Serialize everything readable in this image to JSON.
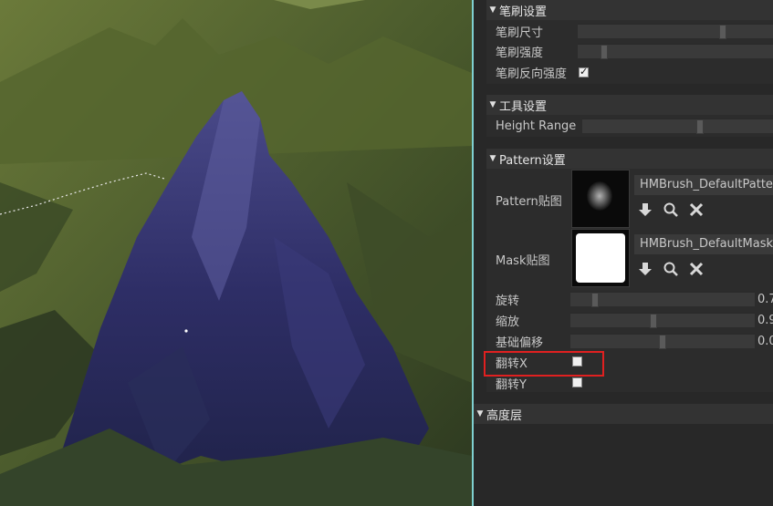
{
  "brush_settings": {
    "title": "笔刷设置",
    "brush_size_label": "笔刷尺寸",
    "brush_size_level": 0.75,
    "brush_strength_label": "笔刷强度",
    "brush_strength_level": 0.12,
    "invert_strength_label": "笔刷反向强度",
    "invert_strength_checked": true
  },
  "tool_settings": {
    "title": "工具设置",
    "height_range_label": "Height Range",
    "height_range_level": 0.62
  },
  "pattern_settings": {
    "title": "Pattern设置",
    "pattern_texture_label": "Pattern贴图",
    "pattern_texture_value": "HMBrush_DefaultPattern",
    "mask_texture_label": "Mask贴图",
    "mask_texture_value": "HMBrush_DefaultMask.",
    "rotation_label": "旋转",
    "rotation_value": "0.7",
    "rotation_level": 0.12,
    "scale_label": "缩放",
    "scale_value": "0.9",
    "scale_level": 0.45,
    "base_offset_label": "基础偏移",
    "base_offset_value": "0.0",
    "base_offset_level": 0.5,
    "flip_x_label": "翻转X",
    "flip_x_checked": false,
    "flip_y_label": "翻转Y",
    "flip_y_checked": false
  },
  "height_layer": {
    "title": "高度层"
  },
  "icons": {
    "use_asset": "down-arrow-icon",
    "browse_asset": "magnifier-icon",
    "clear_asset": "close-x-icon",
    "expand": "triangle-down-icon"
  },
  "colors": {
    "panel_bg": "#282828",
    "header_bg": "#333333",
    "highlight": "#e02020",
    "divider": "#7fd0d0"
  }
}
